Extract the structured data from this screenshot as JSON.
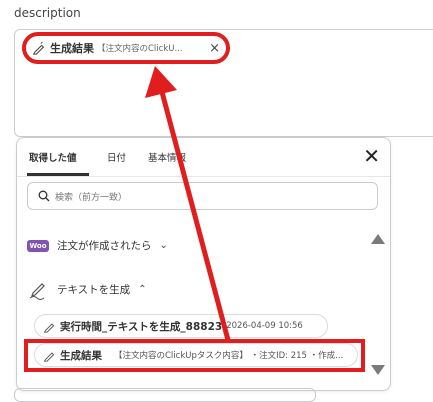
{
  "field": {
    "label": "description"
  },
  "selected_chip": {
    "label": "生成結果",
    "value": "【注文内容のClickU...",
    "remove_icon": "×"
  },
  "panel": {
    "tabs": [
      {
        "label": "取得した値",
        "active": true
      },
      {
        "label": "日付",
        "active": false
      },
      {
        "label": "基本情報",
        "active": false
      }
    ],
    "close_icon": "✕",
    "search": {
      "placeholder": "検索（前方一致）"
    },
    "sections": [
      {
        "icon": "woocommerce-icon",
        "badge": "Woo",
        "title": "注文が作成されたら",
        "chevron": "⌄",
        "expanded": false
      },
      {
        "icon": "pen-sparkle-icon",
        "title": "テキストを生成",
        "chevron": "⌃",
        "expanded": true
      }
    ],
    "items": [
      {
        "label": "実行時間_テキストを生成_88823",
        "value": "2026-04-09 10:56"
      },
      {
        "label": "生成結果",
        "value": "【注文内容のClickUpタスク内容】 ・注文ID: 215 ・作成..."
      }
    ]
  },
  "colors": {
    "highlight": "#e01e1e",
    "woo": "#7f54b3"
  }
}
